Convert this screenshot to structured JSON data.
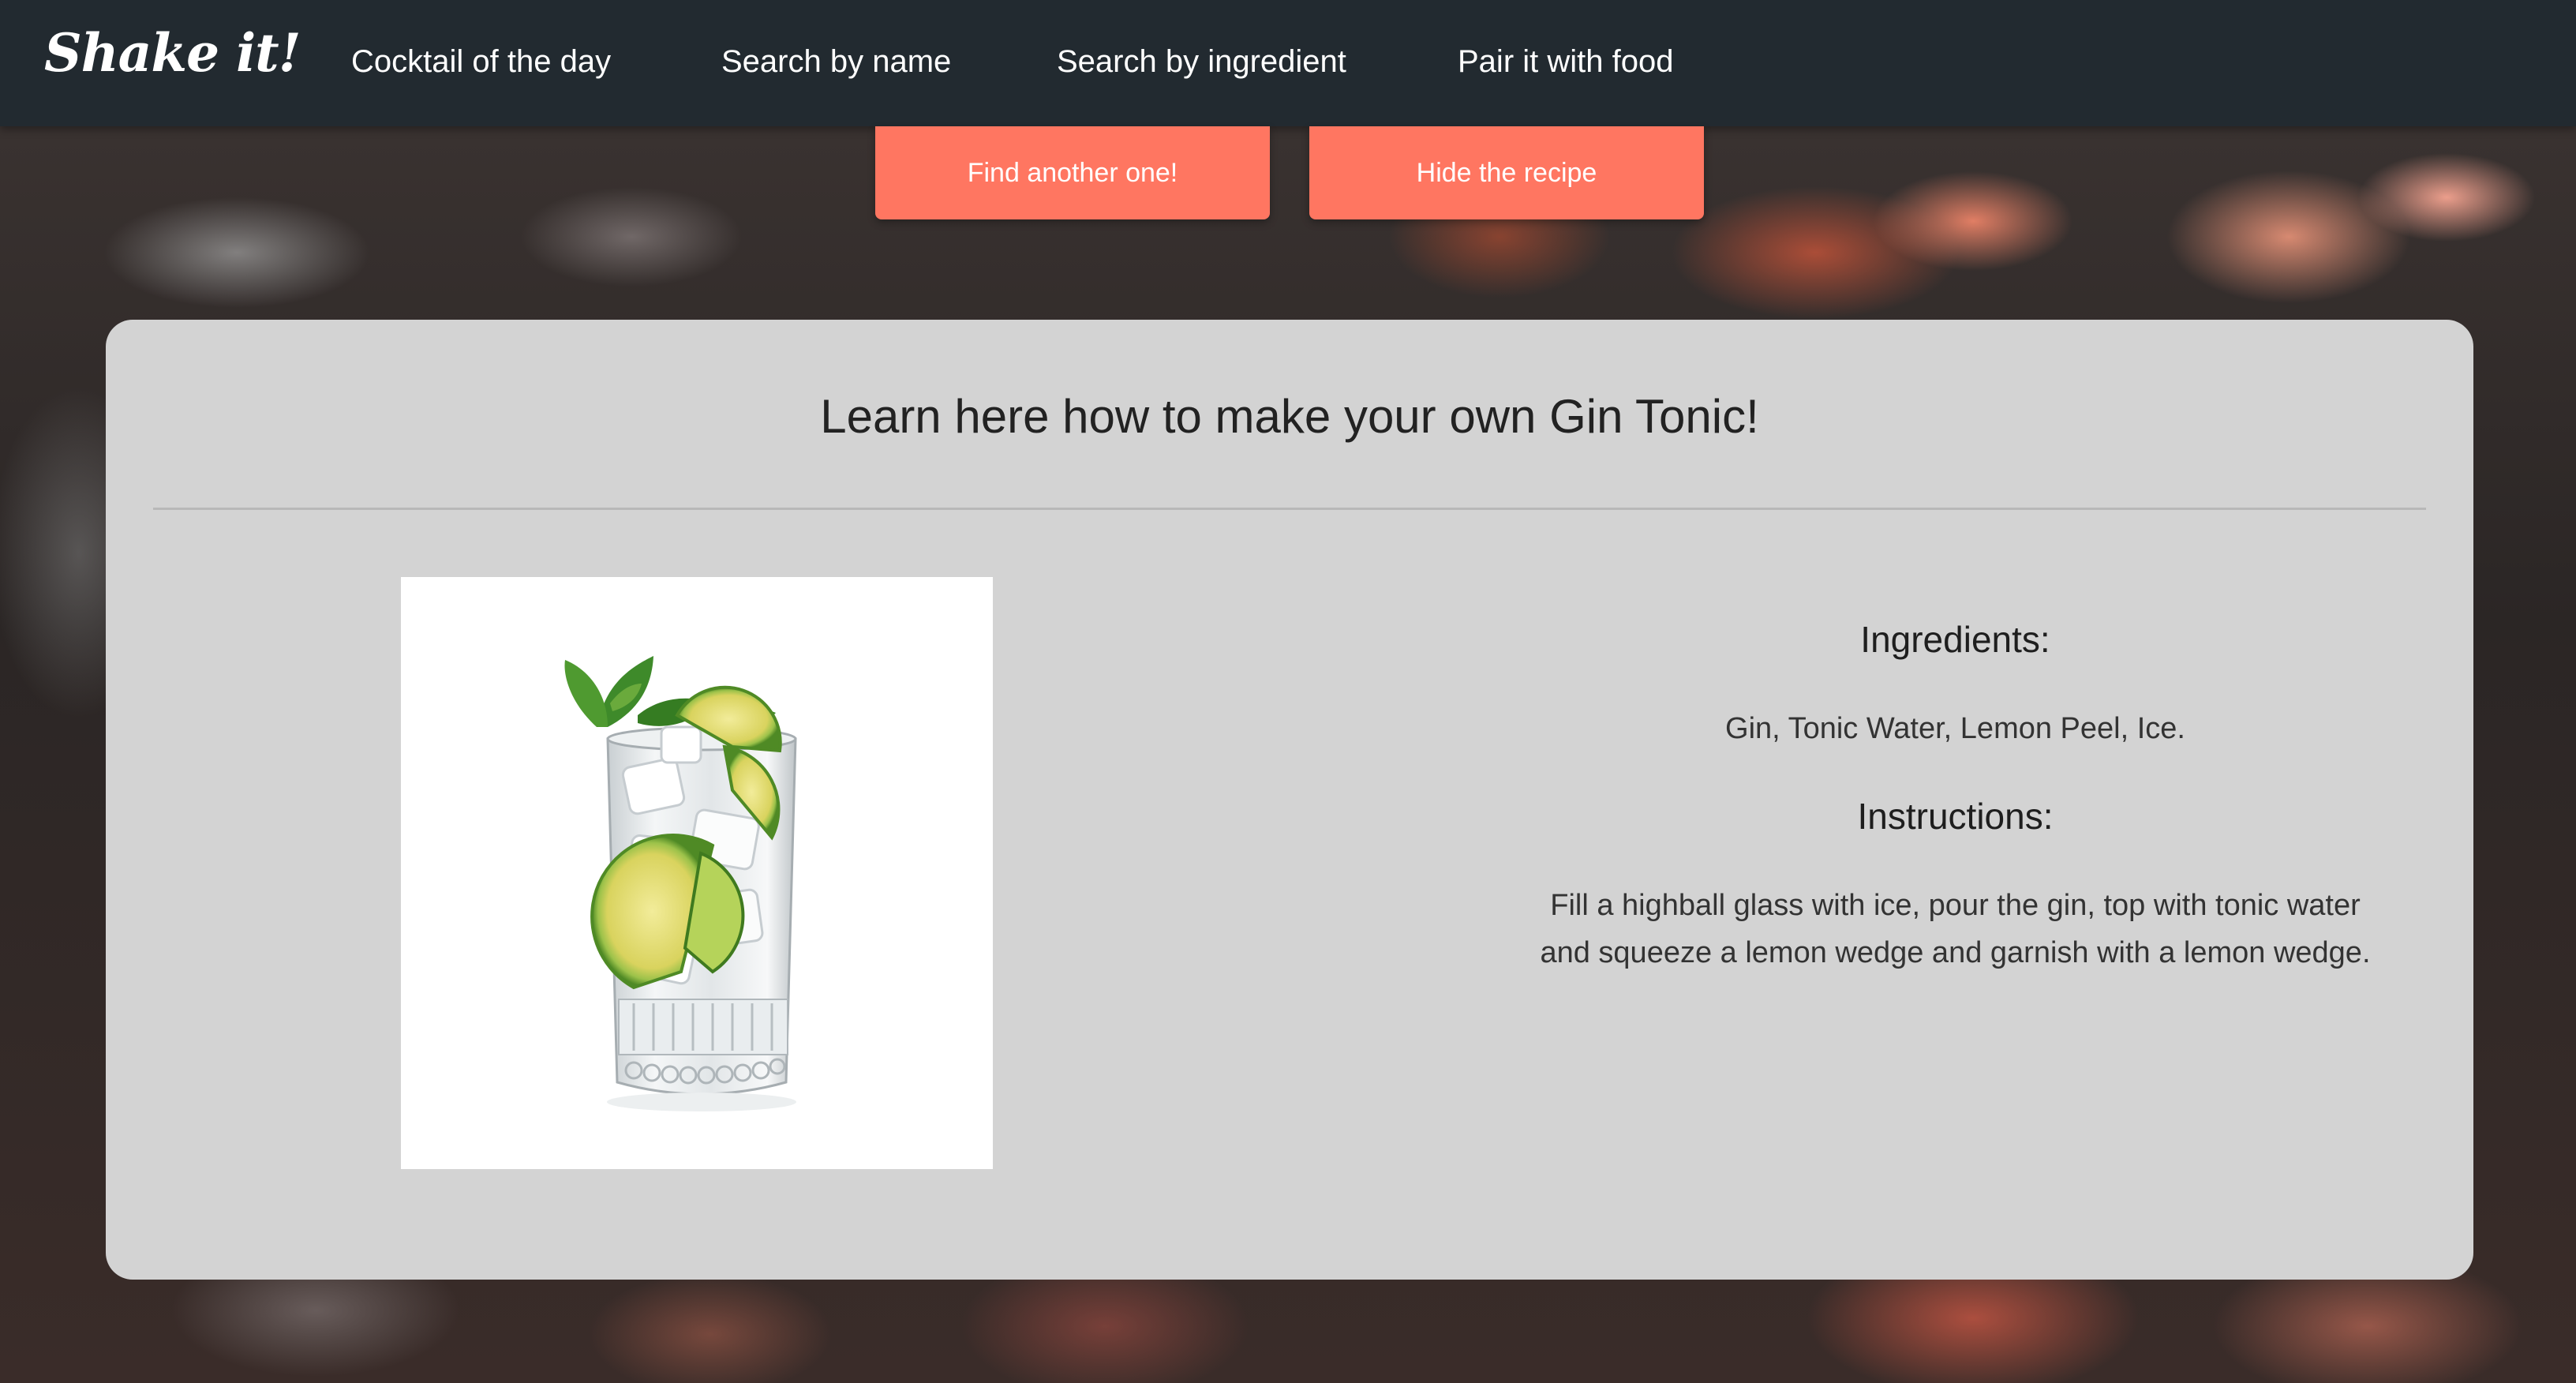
{
  "navbar": {
    "logo": "Shake it!",
    "links": [
      "Cocktail of the day",
      "Search by name",
      "Search by ingredient",
      "Pair it with food"
    ]
  },
  "actions": {
    "find_another": "Find another one!",
    "hide_recipe": "Hide the recipe"
  },
  "recipe": {
    "title": "Learn here how to make your own Gin Tonic!",
    "ingredients_heading": "Ingredients:",
    "ingredients": "Gin, Tonic Water, Lemon Peel, Ice.",
    "instructions_heading": "Instructions:",
    "instructions": "Fill a highball glass with ice, pour the gin, top with tonic water and squeeze a lemon wedge and garnish with a lemon wedge."
  },
  "colors": {
    "navbar": "#222a30",
    "button": "#ff7661",
    "card": "#d3d3d3"
  }
}
